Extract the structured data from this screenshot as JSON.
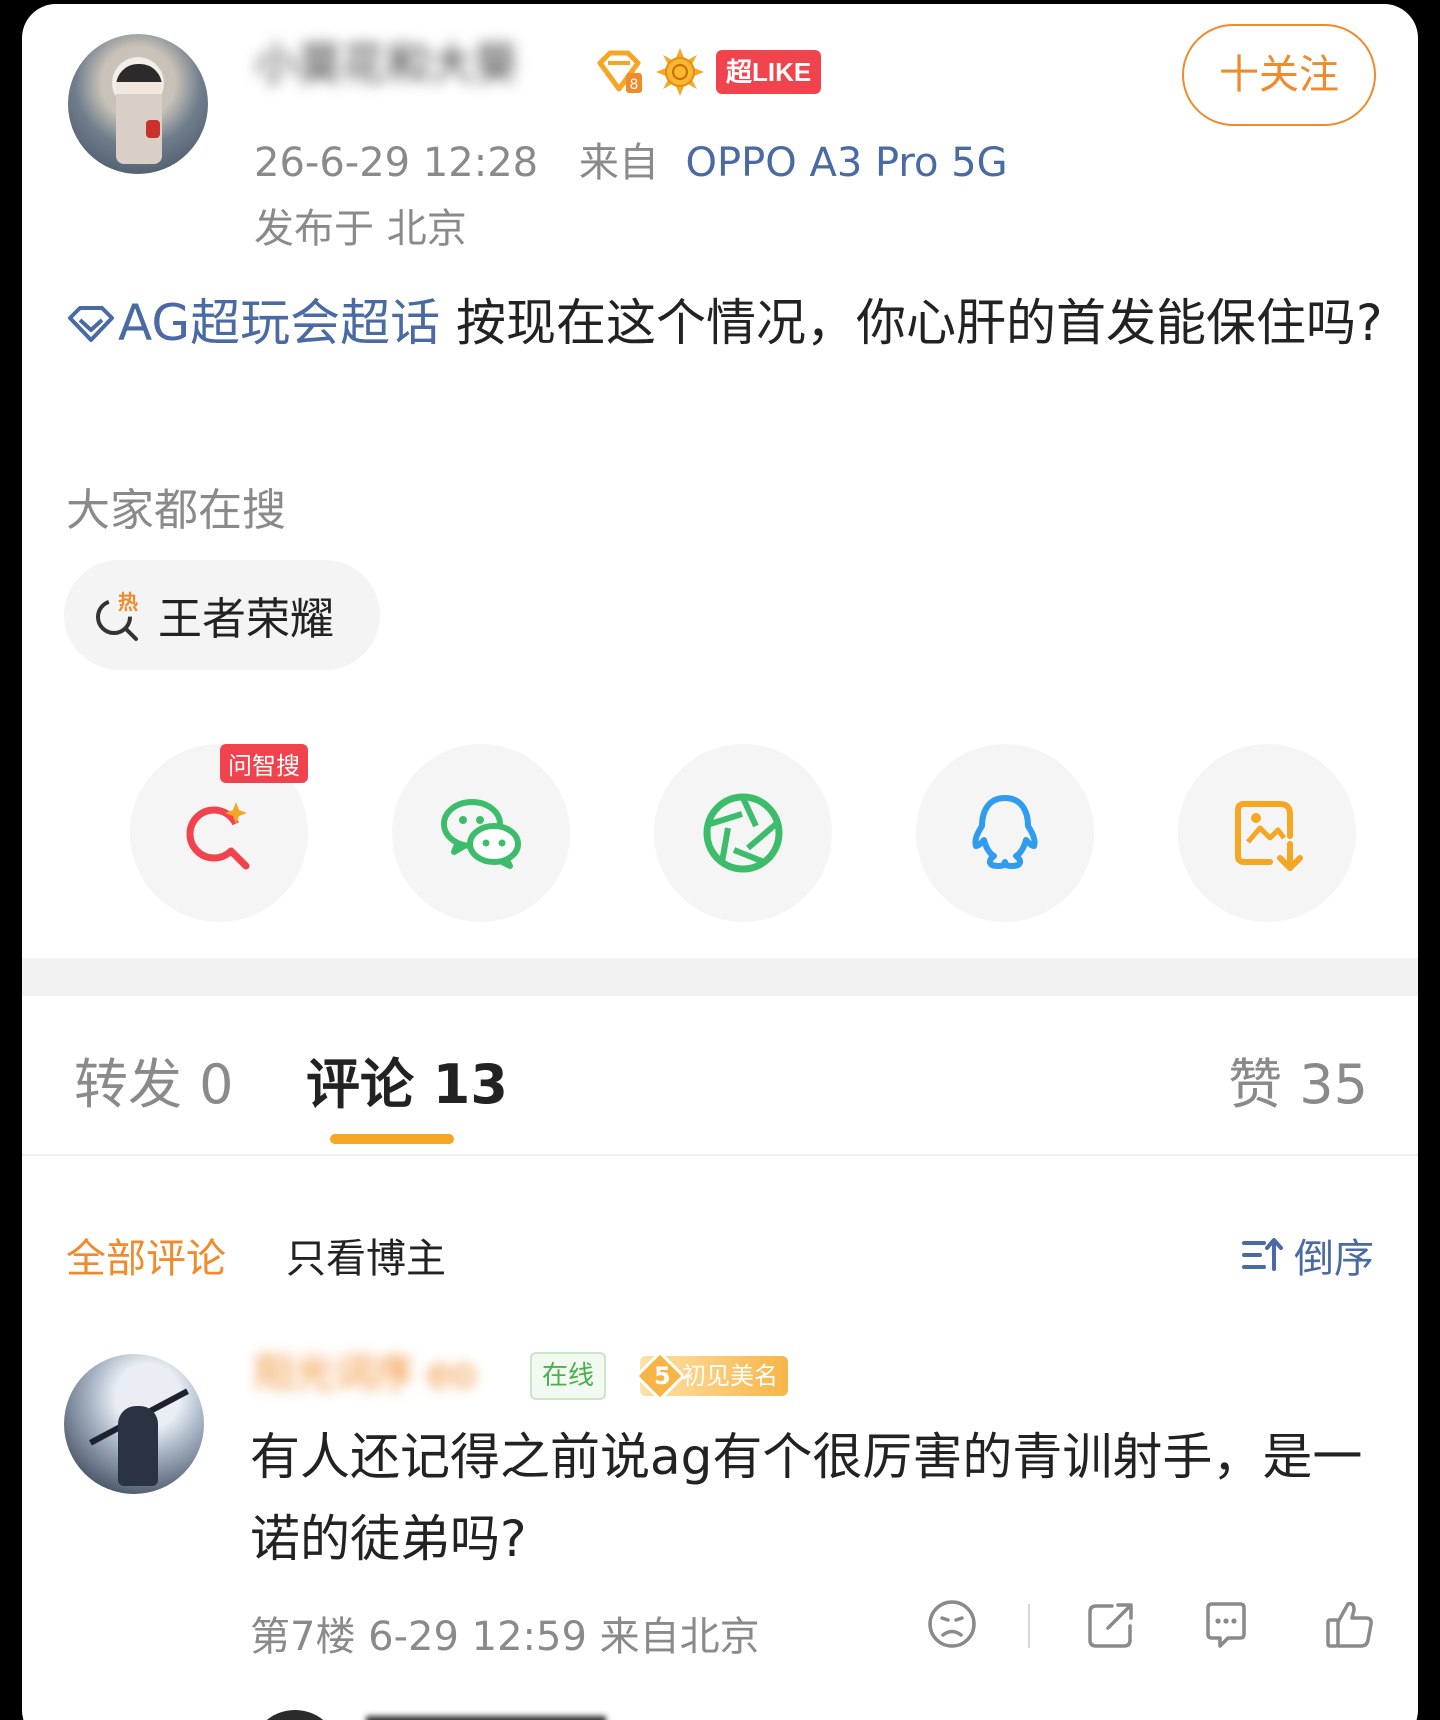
{
  "post": {
    "author_name": "小莫花和大葵",
    "badge_like": "超LIKE",
    "follow_label": "十关注",
    "timestamp": "26-6-29 12:28",
    "source_prefix": "来自",
    "device": "OPPO A3 Pro 5G",
    "location": "发布于 北京",
    "topic": "AG超玩会超话",
    "text": " 按现在这个情况，你心肝的首发能保住吗?",
    "search_hint": "大家都在搜",
    "search_chip": "王者荣耀"
  },
  "share": {
    "ai_tag": "问智搜",
    "items": [
      {
        "icon": "ai-search-icon"
      },
      {
        "icon": "wechat-icon"
      },
      {
        "icon": "moments-icon"
      },
      {
        "icon": "qq-icon"
      },
      {
        "icon": "save-image-icon"
      }
    ]
  },
  "tabs": {
    "repost": "转发 0",
    "comment": "评论 13",
    "like": "赞 35"
  },
  "filters": {
    "all": "全部评论",
    "author_only": "只看博主",
    "sort": "倒序"
  },
  "comment": {
    "name": "阳光词序 eo",
    "online": "在线",
    "fan_level": "5",
    "fan_title": "初见美名",
    "text": "有人还记得之前说ag有个很厉害的青训射手，是一诺的徒弟吗?",
    "floor_meta": "第7楼  6-29 12:59  来自北京"
  },
  "colors": {
    "accent_orange": "#f08a2b",
    "link_blue": "#4a6aa3",
    "like_red": "#f0434d",
    "tab_underline": "#f5a623"
  }
}
